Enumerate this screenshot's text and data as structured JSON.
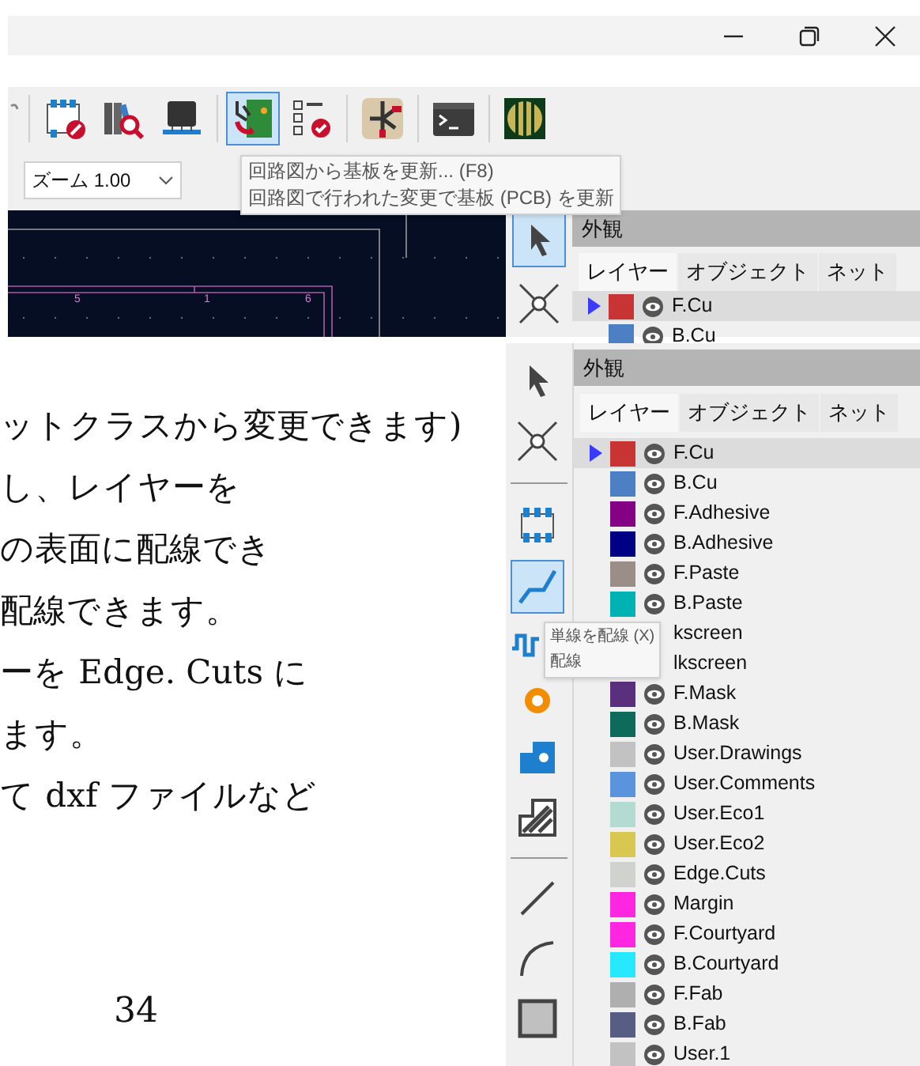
{
  "window_controls": [
    {
      "kind": "minimize"
    },
    {
      "kind": "restore"
    },
    {
      "kind": "close"
    }
  ],
  "toolbar": [
    {
      "kind": "partial",
      "selected": false
    },
    {
      "kind": "footprint-edit",
      "selected": false
    },
    {
      "kind": "library",
      "selected": false
    },
    {
      "kind": "chip",
      "selected": false
    },
    {
      "kind": "update-pcb",
      "selected": true
    },
    {
      "kind": "checklist",
      "selected": false
    },
    {
      "kind": "transistor",
      "selected": false
    },
    {
      "kind": "terminal",
      "selected": false
    },
    {
      "kind": "board",
      "selected": false
    }
  ],
  "zoom_select": {
    "value": "ズーム 1.00"
  },
  "tooltip": {
    "lines": [
      "回路図から基板を更新... (F8)",
      "回路図で行われた変更で基板 (PCB) を更新"
    ]
  },
  "canvas": {
    "labels": [
      "5",
      "1",
      "6"
    ]
  },
  "side_tools": [
    {
      "kind": "select",
      "selected": true
    },
    {
      "kind": "cross",
      "selected": false
    }
  ],
  "appearance_panel": {
    "title": "外観",
    "tabs": [
      {
        "label": "レイヤー",
        "selected": true
      },
      {
        "label": "オブジェクト",
        "selected": false
      },
      {
        "label": "ネット",
        "selected": false
      }
    ],
    "layers": [
      {
        "name": "F.Cu",
        "color": "#c83434",
        "selected": true
      },
      {
        "name": "B.Cu",
        "color": "#4d7fc4",
        "selected": false
      }
    ]
  },
  "document": {
    "lines": [
      "ットクラスから変更できます)",
      "し、レイヤーを",
      "の表面に配線でき",
      "配線できます。",
      "ーを Edge. Cuts に",
      "ます。",
      "て dxf ファイルなど"
    ],
    "page_number": "34"
  },
  "appearance_panel_2": {
    "title": "外観",
    "tabs": [
      {
        "label": "レイヤー",
        "selected": true
      },
      {
        "label": "オブジェクト",
        "selected": false
      },
      {
        "label": "ネット",
        "selected": false
      }
    ],
    "tools": [
      {
        "kind": "select",
        "selected": false
      },
      {
        "kind": "cross",
        "selected": false
      },
      {
        "kind": "separator"
      },
      {
        "kind": "footprint",
        "selected": false
      },
      {
        "kind": "route",
        "selected": true
      },
      {
        "kind": "meander",
        "selected": false
      },
      {
        "kind": "via",
        "selected": false
      },
      {
        "kind": "pad",
        "selected": false
      },
      {
        "kind": "hatch",
        "selected": false
      },
      {
        "kind": "separator"
      },
      {
        "kind": "line",
        "selected": false
      },
      {
        "kind": "arc",
        "selected": false
      },
      {
        "kind": "rect",
        "selected": false
      }
    ],
    "tooltip": {
      "lines": [
        "単線を配線 (X)",
        "配線"
      ]
    },
    "layers": [
      {
        "name": "F.Cu",
        "color": "#c83434",
        "selected": true
      },
      {
        "name": "B.Cu",
        "color": "#4d7fc4",
        "selected": false
      },
      {
        "name": "F.Adhesive",
        "color": "#840084",
        "selected": false
      },
      {
        "name": "B.Adhesive",
        "color": "#000084",
        "selected": false
      },
      {
        "name": "F.Paste",
        "color": "#9b8e89",
        "selected": false
      },
      {
        "name": "B.Paste",
        "color": "#00b2b2",
        "selected": false
      },
      {
        "name": "kscreen",
        "selected": false
      },
      {
        "name": "lkscreen",
        "selected": false
      },
      {
        "name": "F.Mask",
        "color": "#5a2f7d",
        "selected": false
      },
      {
        "name": "B.Mask",
        "color": "#0e6a5a",
        "selected": false
      },
      {
        "name": "User.Drawings",
        "color": "#c2c2c2",
        "selected": false
      },
      {
        "name": "User.Comments",
        "color": "#5994dc",
        "selected": false
      },
      {
        "name": "User.Eco1",
        "color": "#b4dbd2",
        "selected": false
      },
      {
        "name": "User.Eco2",
        "color": "#d8c852",
        "selected": false
      },
      {
        "name": "Edge.Cuts",
        "color": "#d0d2cd",
        "selected": false
      },
      {
        "name": "Margin",
        "color": "#ff26e2",
        "selected": false
      },
      {
        "name": "F.Courtyard",
        "color": "#ff26e2",
        "selected": false
      },
      {
        "name": "B.Courtyard",
        "color": "#26e9ff",
        "selected": false
      },
      {
        "name": "F.Fab",
        "color": "#afafaf",
        "selected": false
      },
      {
        "name": "B.Fab",
        "color": "#585d84",
        "selected": false
      },
      {
        "name": "User.1",
        "color": "#c2c2c2",
        "selected": false
      }
    ]
  }
}
